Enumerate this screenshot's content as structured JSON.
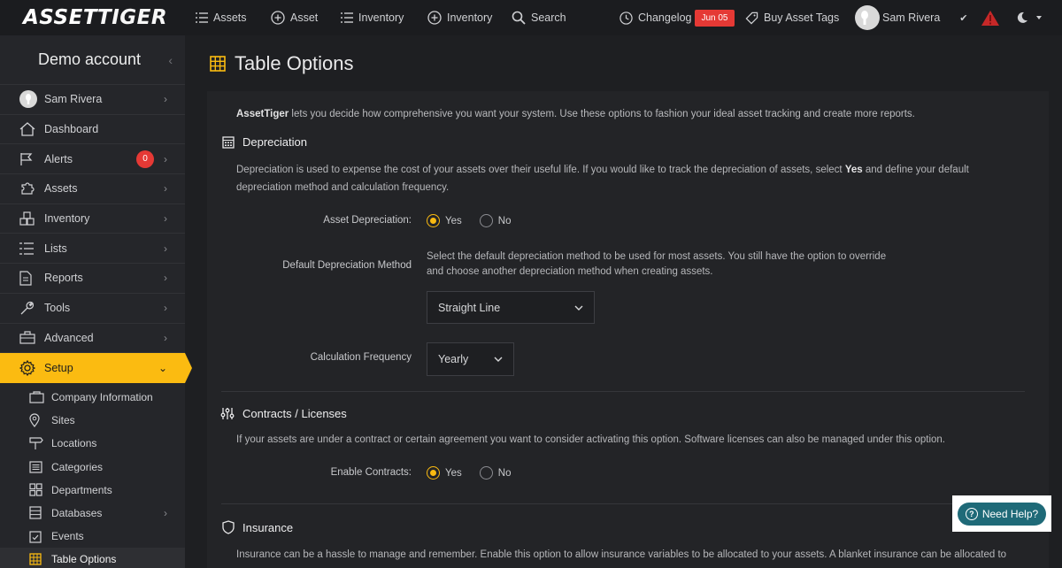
{
  "brand": {
    "asset": "ASSET",
    "tiger": "TIGER"
  },
  "topnav": {
    "assets": "Assets",
    "add_asset": "Asset",
    "inventory": "Inventory",
    "add_inventory": "Inventory",
    "search": "Search",
    "changelog": "Changelog",
    "changelog_date": "Jun 05",
    "buy_tags": "Buy Asset Tags",
    "user": "Sam Rivera"
  },
  "sidebar": {
    "account": "Demo account",
    "user": "Sam Rivera",
    "items": [
      {
        "label": "Dashboard"
      },
      {
        "label": "Alerts",
        "badge": "0"
      },
      {
        "label": "Assets"
      },
      {
        "label": "Inventory"
      },
      {
        "label": "Lists"
      },
      {
        "label": "Reports"
      },
      {
        "label": "Tools"
      },
      {
        "label": "Advanced"
      },
      {
        "label": "Setup"
      }
    ],
    "setup_items": [
      {
        "label": "Company Information"
      },
      {
        "label": "Sites"
      },
      {
        "label": "Locations"
      },
      {
        "label": "Categories"
      },
      {
        "label": "Departments"
      },
      {
        "label": "Databases"
      },
      {
        "label": "Events"
      },
      {
        "label": "Table Options"
      }
    ]
  },
  "page": {
    "title": "Table Options",
    "intro_brand": "AssetTiger",
    "intro_text": " lets you decide how comprehensive you want your system. Use these options to fashion your ideal asset tracking and create more reports."
  },
  "depreciation": {
    "title": "Depreciation",
    "desc_a": "Depreciation is used to expense the cost of your assets over their useful life. If you would like to track the depreciation of assets, select ",
    "desc_bold": "Yes",
    "desc_b": " and define your default",
    "desc_line2": "depreciation method and calculation frequency.",
    "asset_dep_label": "Asset Depreciation:",
    "yes": "Yes",
    "no": "No",
    "method_label": "Default Depreciation Method",
    "method_help_1": "Select the default depreciation method to be used for most assets. You still have the option to override",
    "method_help_2": "and choose another depreciation method when creating assets.",
    "method_value": "Straight Line",
    "freq_label": "Calculation Frequency",
    "freq_value": "Yearly"
  },
  "contracts": {
    "title": "Contracts / Licenses",
    "desc": "If your assets are under a contract or certain agreement you want to consider activating this option. Software licenses can also be managed under this option.",
    "enable_label": "Enable Contracts:",
    "yes": "Yes",
    "no": "No"
  },
  "insurance": {
    "title": "Insurance",
    "desc": "Insurance can be a hassle to manage and remember. Enable this option to allow insurance variables to be allocated to your assets. A blanket insurance can be allocated to"
  },
  "help": {
    "label": "Need Help?"
  },
  "colors": {
    "accent": "#fbbb11",
    "alert": "#e53935",
    "help": "#1f6a78"
  }
}
